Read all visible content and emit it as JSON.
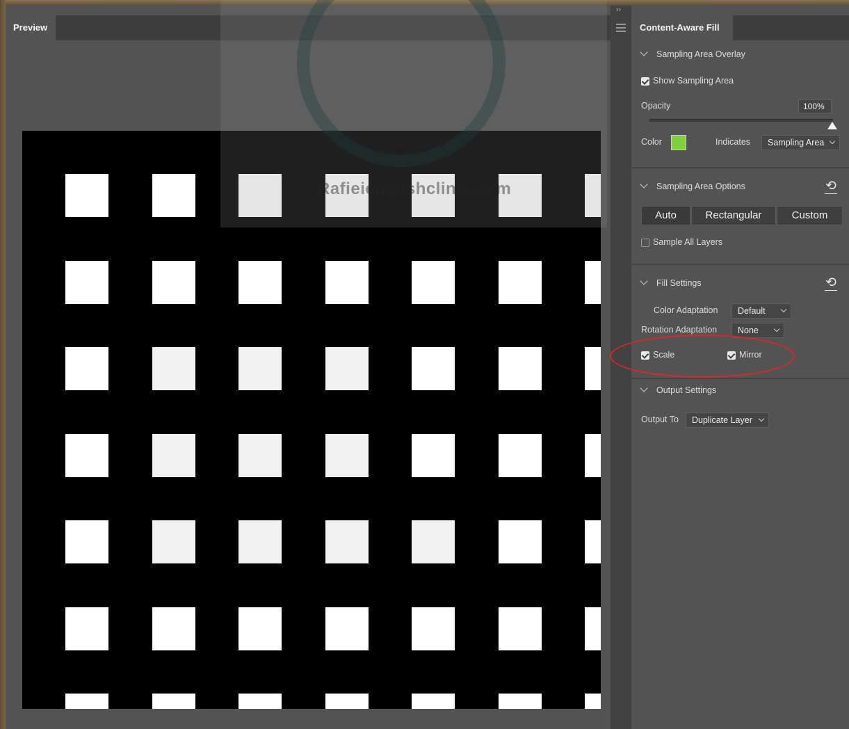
{
  "preview": {
    "tab_label": "Preview",
    "watermark_text": "Rafieienglishclinic.com"
  },
  "panel": {
    "tab_label": "Content-Aware Fill",
    "collapse_glyph": "››",
    "menu_icon": "hamburger-menu-icon"
  },
  "sampling_overlay": {
    "header": "Sampling Area Overlay",
    "show_label": "Show Sampling Area",
    "show_checked": true,
    "opacity_label": "Opacity",
    "opacity_value": "100%",
    "opacity_fraction": 1.0,
    "color_label": "Color",
    "color_value": "#7fd13b",
    "indicates_label": "Indicates",
    "indicates_value": "Sampling Area"
  },
  "sampling_options": {
    "header": "Sampling Area Options",
    "reset_icon": "reset-icon",
    "buttons": [
      "Auto",
      "Rectangular",
      "Custom"
    ],
    "sample_all_label": "Sample All Layers",
    "sample_all_checked": false
  },
  "fill_settings": {
    "header": "Fill Settings",
    "reset_icon": "reset-icon",
    "color_adaptation_label": "Color Adaptation",
    "color_adaptation_value": "Default",
    "rotation_adaptation_label": "Rotation Adaptation",
    "rotation_adaptation_value": "None",
    "scale_label": "Scale",
    "scale_checked": true,
    "mirror_label": "Mirror",
    "mirror_checked": true
  },
  "output_settings": {
    "header": "Output Settings",
    "output_to_label": "Output To",
    "output_to_value": "Duplicate Layer"
  },
  "colors": {
    "panel_bg": "#535353",
    "tab_bar": "#3e3e3e",
    "annotation_red": "#e0242b"
  }
}
